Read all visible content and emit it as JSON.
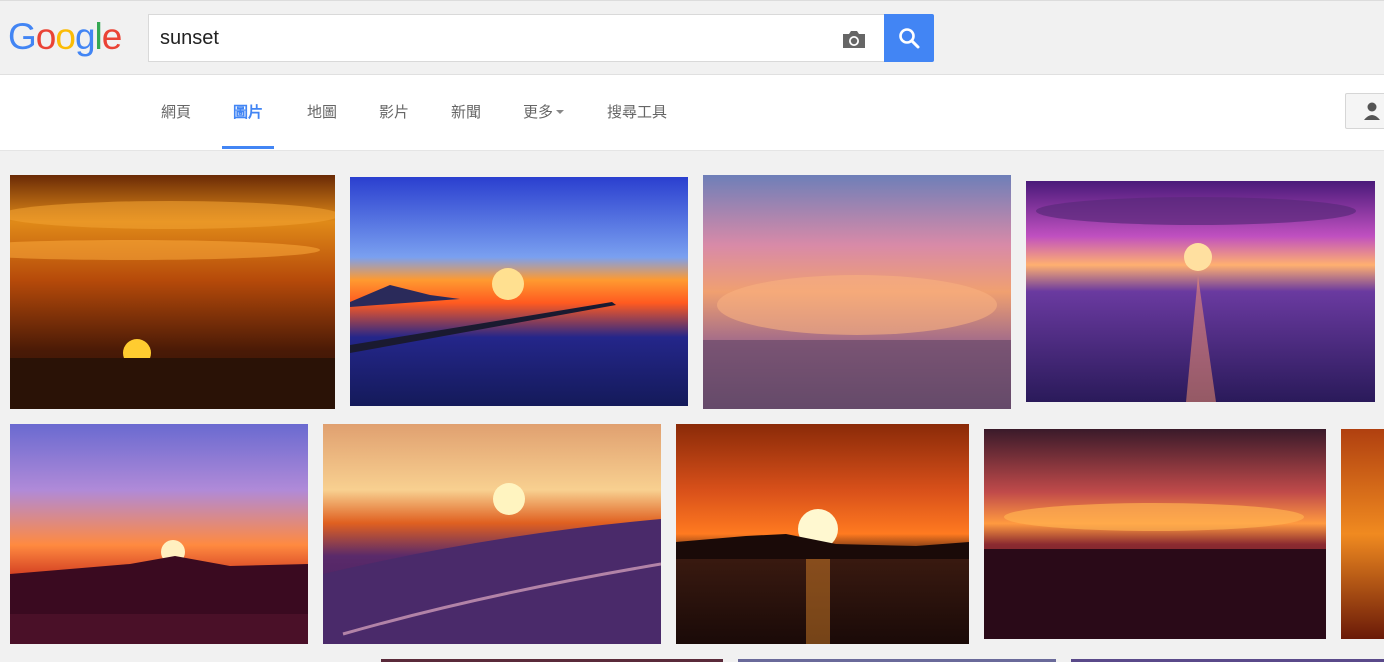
{
  "logo": {
    "letters": [
      "G",
      "o",
      "o",
      "g",
      "l",
      "e"
    ],
    "colors": [
      "#4285f4",
      "#ea4335",
      "#fbbc05",
      "#4285f4",
      "#34a853",
      "#ea4335"
    ]
  },
  "search": {
    "query": "sunset"
  },
  "icons": {
    "camera": "camera-icon",
    "search": "search-icon",
    "user": "user-icon"
  },
  "tabs": [
    {
      "label": "網頁"
    },
    {
      "label": "圖片",
      "active": true
    },
    {
      "label": "地圖"
    },
    {
      "label": "影片"
    },
    {
      "label": "新聞"
    },
    {
      "label": "更多"
    },
    {
      "label": "搜尋工具"
    }
  ],
  "colors": {
    "accent": "#4285f4",
    "page_bg": "#f1f1f1"
  },
  "images": [
    {
      "desc": "sunset-1"
    },
    {
      "desc": "sunset-2"
    },
    {
      "desc": "sunset-3"
    },
    {
      "desc": "sunset-4"
    },
    {
      "desc": "sunset-5"
    },
    {
      "desc": "sunset-6"
    },
    {
      "desc": "sunset-7"
    },
    {
      "desc": "sunset-8"
    },
    {
      "desc": "sunset-9"
    }
  ]
}
